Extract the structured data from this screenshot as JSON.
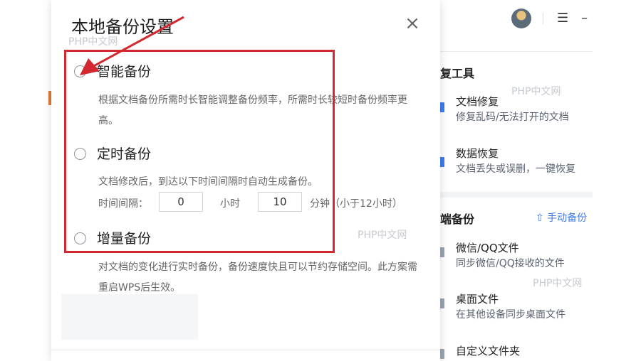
{
  "modal": {
    "title": "本地备份设置",
    "close_label": "×",
    "options": [
      {
        "label": "智能备份",
        "desc": "根据文档备份所需时长智能调整备份频率，所需时长较短时备份频率更高。"
      },
      {
        "label": "定时备份",
        "desc": "文档修改后，到达以下时间间隔时自动生成备份。"
      },
      {
        "label": "增量备份",
        "desc": "对文档的变化进行实时备份，备份速度快且可以节约存储空间。此方案需重启WPS后生效。"
      }
    ],
    "interval": {
      "label": "时间间隔：",
      "hours_value": "0",
      "hours_unit": "小时",
      "minutes_value": "10",
      "minutes_unit": "分钟（小于12小时）"
    }
  },
  "background_app": {
    "menu_icon": "☰",
    "min_icon": "–",
    "tools_title": "复工具",
    "tools": [
      {
        "title": "文档修复",
        "desc": "修复乱码/无法打开的文档"
      },
      {
        "title": "数据恢复",
        "desc": "文档丢失或误删，一键恢复"
      }
    ],
    "backup_title": "端备份",
    "manual_backup": "⇧ 手动备份",
    "backups": [
      {
        "title": "微信/QQ文件",
        "desc": "同步微信/QQ接收的文件"
      },
      {
        "title": "桌面文件",
        "desc": "在其他设备同步桌面文件"
      },
      {
        "title": "自定义文件夹",
        "desc": ""
      }
    ]
  },
  "watermarks": {
    "text": "PHP中文网"
  },
  "colors": {
    "accent": "#3d7af0",
    "annotation_red": "#d1292f"
  }
}
